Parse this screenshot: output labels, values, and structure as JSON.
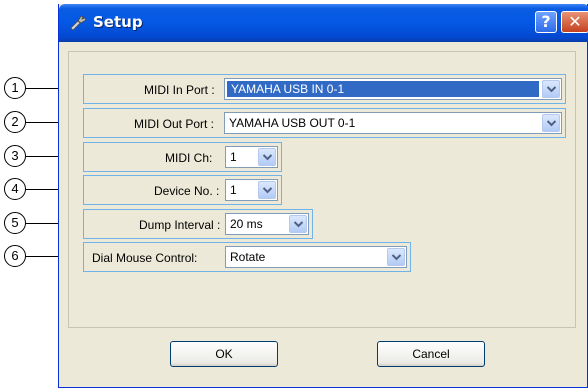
{
  "window": {
    "title": "Setup",
    "help_label": "?",
    "close_label": "✕"
  },
  "fields": [
    {
      "number": "1",
      "label": "MIDI In Port :",
      "value": "YAMAHA USB IN 0-1"
    },
    {
      "number": "2",
      "label": "MIDI Out Port :",
      "value": "YAMAHA USB OUT 0-1"
    },
    {
      "number": "3",
      "label": "MIDI Ch:",
      "value": "1"
    },
    {
      "number": "4",
      "label": "Device No. :",
      "value": "1"
    },
    {
      "number": "5",
      "label": "Dump Interval :",
      "value": "20 ms"
    },
    {
      "number": "6",
      "label": "Dial Mouse Control:",
      "value": "Rotate"
    }
  ],
  "buttons": {
    "ok_label": "OK",
    "cancel_label": "Cancel"
  },
  "colors": {
    "titlebar": "#0458e4",
    "dialog_bg": "#ece9d8",
    "highlight": "#316ac5",
    "row_border": "#6fb3e8"
  }
}
